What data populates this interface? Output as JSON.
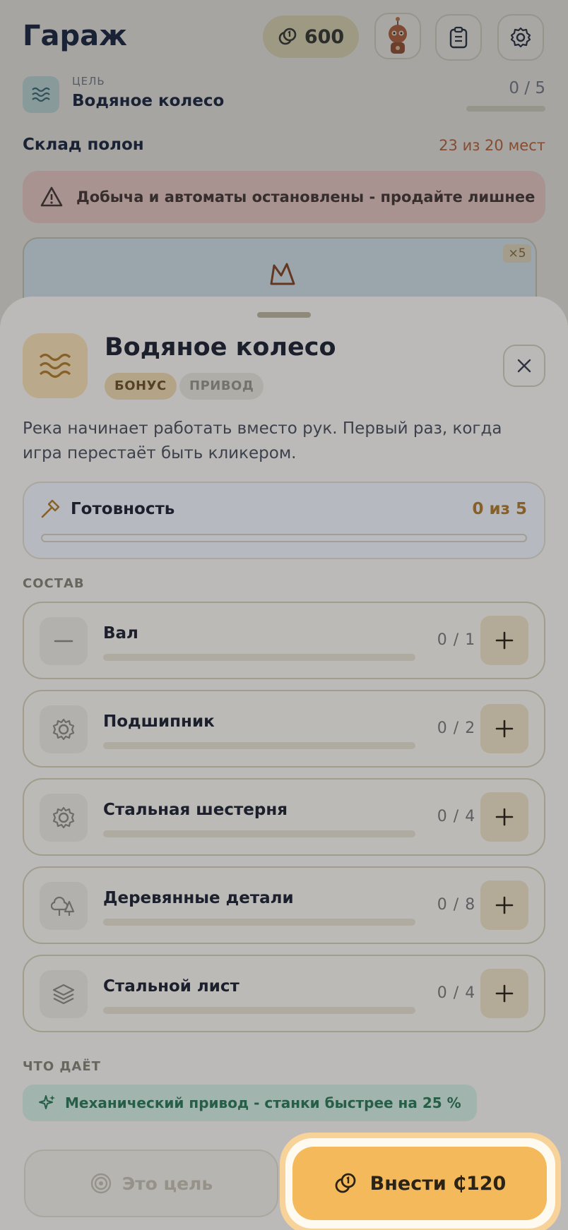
{
  "header": {
    "title": "Гараж",
    "coins": "600"
  },
  "goal": {
    "caption": "ЦЕЛЬ",
    "name": "Водяное колесо",
    "progress_text": "0 / 5"
  },
  "storage": {
    "title": "Склад полон",
    "count_text": "23 из 20 мест",
    "warning": "Добыча и автоматы остановлены - продайте лишнее",
    "item_badge": "×5"
  },
  "sheet": {
    "title": "Водяное колесо",
    "badges": [
      "БОНУС",
      "ПРИВОД"
    ],
    "description": "Река начинает работать вместо рук. Первый раз, когда игра перестаёт быть кликером.",
    "readiness": {
      "label": "Готовность",
      "value_text": "0 из 5",
      "fraction": 0
    },
    "composition_caption": "СОСТАВ",
    "components": [
      {
        "name": "Вал",
        "count": "0 / 1",
        "icon": "dash-icon"
      },
      {
        "name": "Подшипник",
        "count": "0 / 2",
        "icon": "gear-icon"
      },
      {
        "name": "Стальная шестерня",
        "count": "0 / 4",
        "icon": "gear-icon"
      },
      {
        "name": "Деревянные детали",
        "count": "0 / 8",
        "icon": "trees-icon"
      },
      {
        "name": "Стальной лист",
        "count": "0 / 4",
        "icon": "layers-icon"
      }
    ],
    "gives_caption": "ЧТО ДАЁТ",
    "bonus_text": "Механический привод - станки быстрее на 25 %",
    "goal_button": "Это цель",
    "pay_button": "Внести ₵120"
  },
  "colors": {
    "accent": "#f4b95a",
    "warning_bg": "#f6d4cb",
    "bonus_green": "#2f7a58"
  }
}
